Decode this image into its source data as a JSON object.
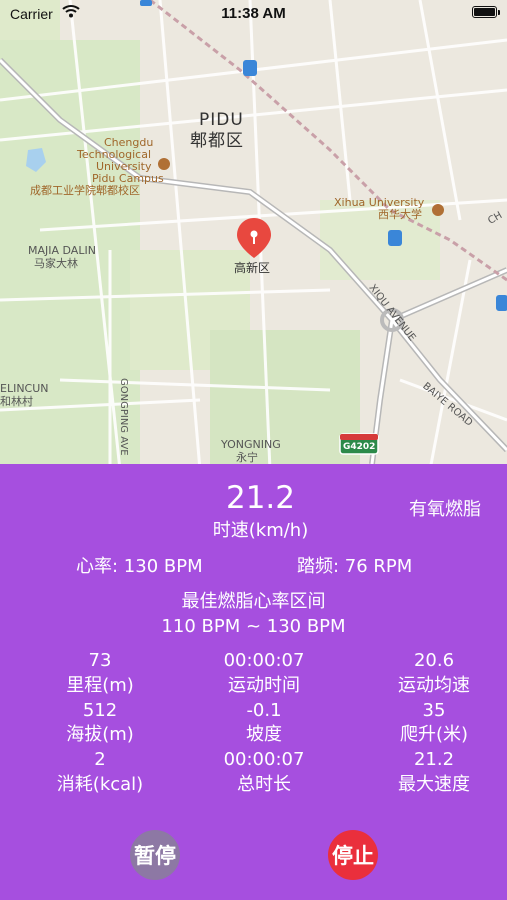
{
  "status_bar": {
    "carrier": "Carrier",
    "time": "11:38 AM"
  },
  "map": {
    "labels": {
      "pidu_en": "PIDU",
      "pidu_cn": "郫都区",
      "chengdu_1": "Chengdu",
      "chengdu_2": "Technological",
      "chengdu_3": "University",
      "chengdu_4": "Pidu Campus",
      "chengdu_cn": "成都工业学院郫都校区",
      "xihua_en": "Xihua University",
      "xihua_cn": "西华大学",
      "majia_en": "MAJIA DALIN",
      "majia_cn": "马家大林",
      "gaoxin": "高新区",
      "xiqu": "XIQU AVENUE",
      "elincun_en": "ELINCUN",
      "elincun_cn": "和林村",
      "gongping": "GONGPING AVE",
      "yongning_en": "YONGNING",
      "yongning_cn": "永宁",
      "baiye": "BAIYE ROAD",
      "highway": "G4202",
      "edge_ch": "CH"
    }
  },
  "workout": {
    "speed_value": "21.2",
    "speed_label": "时速(km/h)",
    "mode": "有氧燃脂",
    "heart_rate": "心率: 130  BPM",
    "cadence": "踏频: 76  RPM",
    "zone_title": "最佳燃脂心率区间",
    "zone_range": "110  BPM  ~  130  BPM",
    "stats": [
      {
        "value": "73",
        "label": "里程(m)"
      },
      {
        "value": "00:00:07",
        "label": "运动时间"
      },
      {
        "value": "20.6",
        "label": "运动均速"
      },
      {
        "value": "512",
        "label": "海拔(m)"
      },
      {
        "value": "-0.1",
        "label": "坡度"
      },
      {
        "value": "35",
        "label": "爬升(米)"
      },
      {
        "value": "2",
        "label": "消耗(kcal)"
      },
      {
        "value": "00:00:07",
        "label": "总时长"
      },
      {
        "value": "21.2",
        "label": "最大速度"
      }
    ]
  },
  "buttons": {
    "pause": "暂停",
    "stop": "停止"
  },
  "colors": {
    "panel": "#a64fdf",
    "pause": "#8d78a4",
    "stop": "#ea2f3c",
    "pin": "#e8483f"
  }
}
